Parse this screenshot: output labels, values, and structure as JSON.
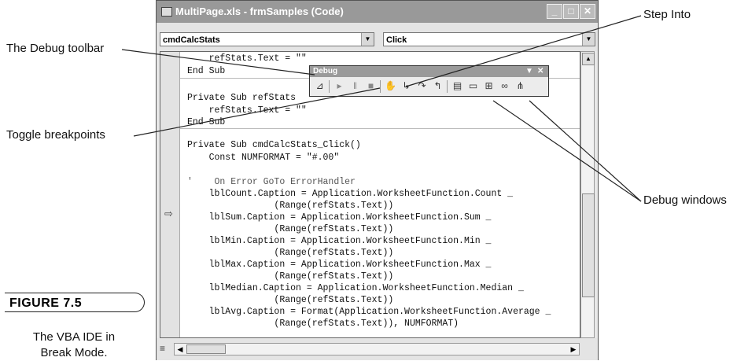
{
  "window": {
    "title": "MultiPage.xls - frmSamples (Code)",
    "object_combo": "cmdCalcStats",
    "procedure_combo": "Click"
  },
  "code_lines": [
    "    refStats.Text = \"\"",
    "End Sub",
    "Private Sub refStats",
    "    refStats.Text = \"\"",
    "End Sub",
    "Private Sub cmdCalcStats_Click()",
    "    Const NUMFORMAT = \"#.00\"",
    "'    On Error GoTo ErrorHandler",
    "    lblCount.Caption = Application.WorksheetFunction.Count _",
    "                (Range(refStats.Text))",
    "    lblSum.Caption = Application.WorksheetFunction.Sum _",
    "                (Range(refStats.Text))",
    "    lblMin.Caption = Application.WorksheetFunction.Min _",
    "                (Range(refStats.Text))",
    "    lblMax.Caption = Application.WorksheetFunction.Max _",
    "                (Range(refStats.Text))",
    "    lblMedian.Caption = Application.WorksheetFunction.Median _",
    "                (Range(refStats.Text))",
    "    lblAvg.Caption = Format(Application.WorksheetFunction.Average _",
    "                (Range(refStats.Text)), NUMFORMAT)"
  ],
  "debug_toolbar": {
    "title": "Debug",
    "buttons": [
      "design-mode",
      "run",
      "break",
      "reset",
      "toggle-breakpoint",
      "step-into",
      "step-over",
      "step-out",
      "locals-window",
      "immediate-window",
      "watch-window",
      "quick-watch",
      "call-stack"
    ]
  },
  "callouts": {
    "debug_toolbar": "The Debug toolbar",
    "toggle_breakpoints": "Toggle breakpoints",
    "step_into": "Step Into",
    "debug_windows": "Debug windows"
  },
  "figure": {
    "badge": "FIGURE 7.5",
    "caption_line1": "The VBA IDE in",
    "caption_line2": "Break Mode."
  },
  "colors": {
    "titlebar": "#999999",
    "window_bg": "#e8e8e8",
    "code_bg": "#ffffff"
  }
}
